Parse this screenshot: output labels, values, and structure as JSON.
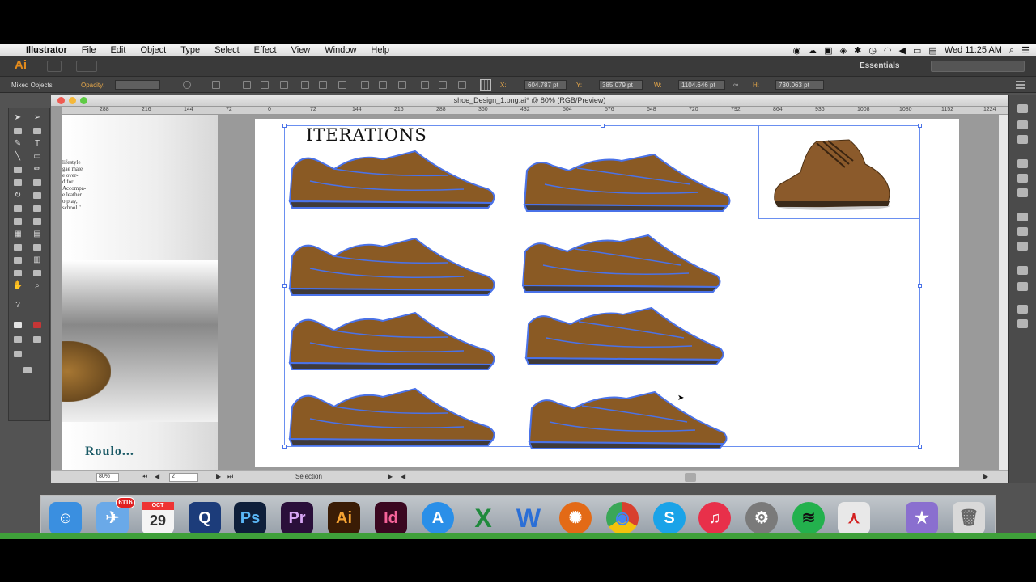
{
  "menubar": {
    "apple": "",
    "app_name": "Illustrator",
    "items": [
      "File",
      "Edit",
      "Object",
      "Type",
      "Select",
      "Effect",
      "View",
      "Window",
      "Help"
    ],
    "datetime": "Wed 11:25 AM"
  },
  "appbar": {
    "logo": "Ai",
    "workspace": "Essentials"
  },
  "controlbar": {
    "selection_type": "Mixed Objects",
    "opacity_label": "Opacity:",
    "x_label": "X:",
    "x_value": "604.787 pt",
    "y_label": "Y:",
    "y_value": "385.079 pt",
    "w_label": "W:",
    "w_value": "1104.646 pt",
    "h_label": "H:",
    "h_value": "730.063 pt"
  },
  "document": {
    "title": "shoe_Design_1.png.ai* @ 80% (RGB/Preview)",
    "ruler_h": [
      "288",
      "216",
      "144",
      "72",
      "0",
      "72",
      "144",
      "216",
      "288",
      "360",
      "432",
      "504",
      "576",
      "648",
      "720",
      "792",
      "864",
      "936",
      "1008",
      "1080",
      "1152",
      "1224"
    ],
    "artboard_heading": "ITERATIONS",
    "left_paragraph": [
      "lifestyle",
      "gae male",
      "e over-",
      "d for",
      "Accompa-",
      "e leather",
      "o play,",
      "school.\""
    ],
    "left_logo": "Roulo...",
    "status": {
      "zoom": "80%",
      "page": "2",
      "tool": "Selection"
    }
  },
  "dock": {
    "apps": [
      {
        "name": "Finder",
        "glyph": "☺",
        "color": "#3a8fe0"
      },
      {
        "name": "Mail",
        "glyph": "✈",
        "color": "#6aa9e8",
        "badge": "6116"
      },
      {
        "name": "Calendar",
        "glyph": "29",
        "color": "#f4f4f4",
        "month": "OCT"
      },
      {
        "name": "QuickTime",
        "glyph": "Q",
        "color": "#1c3c7a"
      },
      {
        "name": "Photoshop",
        "glyph": "Ps",
        "color": "#0e1f3a"
      },
      {
        "name": "Premiere",
        "glyph": "Pr",
        "color": "#2a0f3a"
      },
      {
        "name": "Illustrator",
        "glyph": "Ai",
        "color": "#3a1c05"
      },
      {
        "name": "InDesign",
        "glyph": "Id",
        "color": "#3a0720"
      },
      {
        "name": "App Store",
        "glyph": "A",
        "color": "#2a8fe8"
      },
      {
        "name": "Excel",
        "glyph": "X",
        "color": "#1f8a3c"
      },
      {
        "name": "Word",
        "glyph": "W",
        "color": "#2b6fd6"
      },
      {
        "name": "Firefox",
        "glyph": "✺",
        "color": "#e36a16"
      },
      {
        "name": "Chrome",
        "glyph": "◉",
        "color": "#d8402e"
      },
      {
        "name": "Skype",
        "glyph": "S",
        "color": "#1aa3e8"
      },
      {
        "name": "iTunes",
        "glyph": "♫",
        "color": "#e8304a"
      },
      {
        "name": "System Preferences",
        "glyph": "⚙",
        "color": "#7a7a7a"
      },
      {
        "name": "Spotify",
        "glyph": "≋",
        "color": "#23b14d"
      },
      {
        "name": "Acrobat",
        "glyph": "⋏",
        "color": "#e8e8e8"
      },
      {
        "name": "Game Center",
        "glyph": "★",
        "color": "#8a6fcf"
      },
      {
        "name": "Trash",
        "glyph": "🗑",
        "color": "#d9d9d9"
      }
    ]
  },
  "colors": {
    "accent": "#e38b1c",
    "selection": "#4a72e8",
    "shoe": "#8a5a24"
  }
}
